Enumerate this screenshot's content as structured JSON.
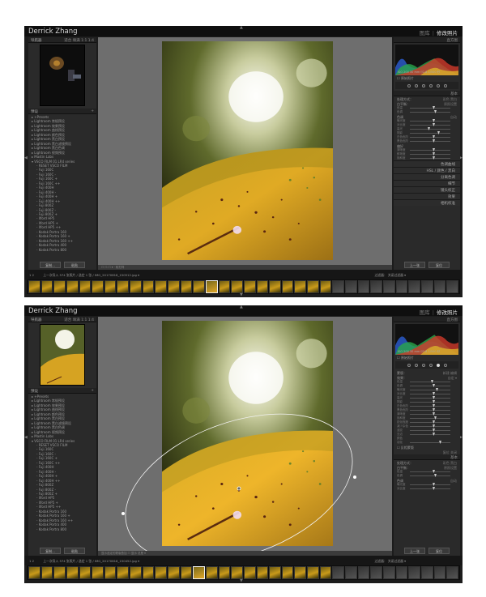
{
  "identity": "Derrick Zhang",
  "modules": [
    "图库",
    "修改照片"
  ],
  "left_panel": {
    "navigator_title": "导航器",
    "navigator_options": "适合 填满 1:1 1:4",
    "presets_title": "预设",
    "presets": [
      "▸ +Presets",
      "▸ Lightroom 常规预设",
      "▸ Lightroom 效果预设",
      "▸ Lightroom 曲线预设",
      "▸ Lightroom 颜色预设",
      "▸ Lightroom 黑白预设",
      "▸ Lightroom 黑白滤镜预设",
      "▸ Lightroom 黑白色调",
      "▸ Lightroom 视频预设",
      "▸ Mastin Labs",
      "▾ VSCO FILM 01 LR4 series"
    ],
    "film_presets": [
      "- RESET VSCO FILM",
      "- Fuji 160C",
      "- Fuji 160C -",
      "- Fuji 160C +",
      "- Fuji 160C ++",
      "- Fuji 400H",
      "- Fuji 400H -",
      "- Fuji 400H +",
      "- Fuji 400H ++",
      "- Fuji 800Z",
      "- Fuji 800Z -",
      "- Fuji 800Z +",
      "- Ilford HP5",
      "- Ilford HP5 +",
      "- Ilford HP5 ++",
      "- Kodak Portra 160",
      "- Kodak Portra 160 +",
      "- Kodak Portra 160 ++",
      "- Kodak Portra 400",
      "- Kodak Portra 800"
    ],
    "copy_button": "复制...",
    "paste_button": "粘贴"
  },
  "toolbar": {
    "win1": "☐ ☐ ☐ ▾ · 软打样",
    "win2": "显示选定的蒙版叠加  ☐ 显示  总是 ▾"
  },
  "right_panel": {
    "histogram_title": "直方图",
    "histogram_info": "ISO 200   30 mm   f/2.8   1/500 秒",
    "original_photo": "☐ 原始照片",
    "basic_title": "基本",
    "treatment_label": "处理方式：",
    "treatment_color": "彩色",
    "treatment_bw": "黑白",
    "wb_label": "白平衡：",
    "wb_value": "原照设置",
    "tone_label": "色调",
    "auto_label": "自动",
    "presence_label": "偏好",
    "sliders_basic": [
      "色温",
      "色调",
      "曝光度",
      "对比度",
      "高光",
      "阴影",
      "白色色阶",
      "黑色色阶",
      "清晰度",
      "鲜艳度",
      "饱和度"
    ],
    "sections": [
      "色调曲线",
      "HSL / 颜色 / 黑白",
      "分离色调",
      "细节",
      "镜头校正",
      "效果",
      "相机校准"
    ],
    "radial_sliders": [
      "色温",
      "色调",
      "曝光度",
      "对比度",
      "高光",
      "阴影",
      "白色色阶",
      "黑色色阶",
      "清晰度",
      "饱和度",
      "锐化程度",
      "减少杂色",
      "波纹",
      "去边",
      "颜色"
    ],
    "mask_label": "蒙版：",
    "mask_new": "新建",
    "mask_edit": "编辑",
    "effect_label": "效果：",
    "effect_preset": "自定 ▾",
    "feather_label": "羽化",
    "invert_label": "☐ 反相蒙版",
    "reset_label": "复位",
    "close_label": "关闭",
    "prev_button": "上一张",
    "reset_button": "复位"
  },
  "filmstrip": {
    "pages": "1  2",
    "source1": "上一次导入  574 张照片 / 选定 1 张 / IMG_20170818_150512.jpg ▾",
    "source2": "上一次导入  574 张照片 / 选定 1 张 / IMG_20170818_150452.jpg ▾",
    "filter_label": "过滤器：",
    "filter_value": "关闭过滤器 ▾"
  },
  "colors": {
    "panel_bg": "#2a2a2a",
    "center_bg": "#6e6e6e",
    "leaf": "#d9a520",
    "active_module": "#efefef"
  }
}
